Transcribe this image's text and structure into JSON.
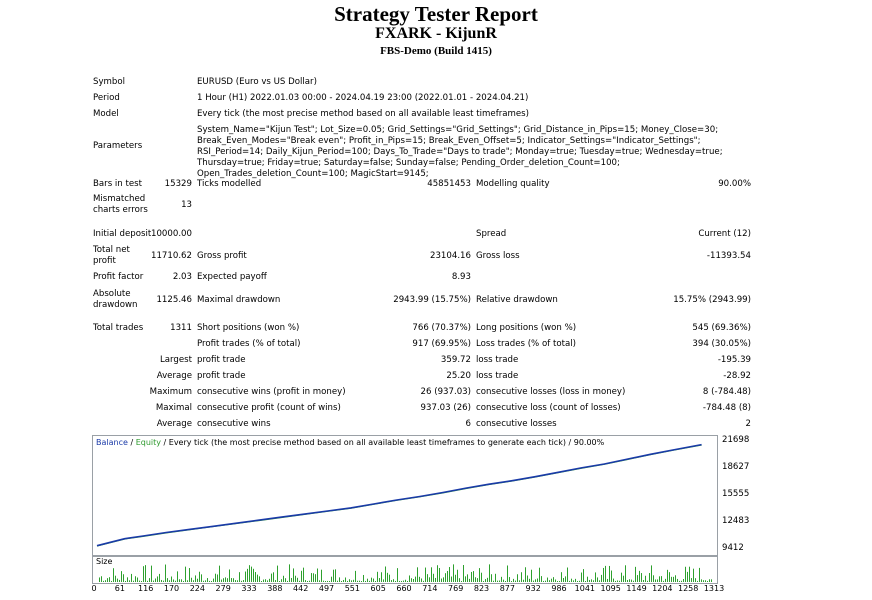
{
  "report": {
    "title": "Strategy Tester Report",
    "subtitle": "FXARK - KijunR",
    "server": "FBS-Demo (Build 1415)"
  },
  "info": {
    "symbol_label": "Symbol",
    "symbol": "EURUSD (Euro vs US Dollar)",
    "period_label": "Period",
    "period": "1 Hour (H1) 2022.01.03 00:00 - 2024.04.19 23:00 (2022.01.01 - 2024.04.21)",
    "model_label": "Model",
    "model": "Every tick (the most precise method based on all available least timeframes)",
    "parameters_label": "Parameters",
    "parameters": "System_Name=\"Kijun Test\"; Lot_Size=0.05; Grid_Settings=\"Grid_Settings\"; Grid_Distance_in_Pips=15; Money_Close=30; Break_Even_Modes=\"Break even\"; Profit_in_Pips=15; Break_Even_Offset=5; Indicator_Settings=\"Indicator_Settings\"; RSI_Period=14; Daily_Kijun_Period=100; Days_To_Trade=\"Days to trade\"; Monday=true; Tuesday=true; Wednesday=true; Thursday=true; Friday=true; Saturday=false; Sunday=false; Pending_Order_deletion_Count=100; Open_Trades_deletion_Count=100; MagicStart=9145;"
  },
  "stats": {
    "bars_label": "Bars in test",
    "bars": "15329",
    "ticks_label": "Ticks modelled",
    "ticks": "45851453",
    "quality_label": "Modelling quality",
    "quality": "90.00%",
    "mismatch_label": "Mismatched charts errors",
    "mismatch": "13",
    "deposit_label": "Initial deposit",
    "deposit": "10000.00",
    "spread_label": "Spread",
    "spread": "Current (12)",
    "netprofit_label": "Total net profit",
    "netprofit": "11710.62",
    "grossprofit_label": "Gross profit",
    "grossprofit": "23104.16",
    "grossloss_label": "Gross loss",
    "grossloss": "-11393.54",
    "pf_label": "Profit factor",
    "pf": "2.03",
    "payoff_label": "Expected payoff",
    "payoff": "8.93",
    "absdd_label": "Absolute drawdown",
    "absdd": "1125.46",
    "maxdd_label": "Maximal drawdown",
    "maxdd": "2943.99 (15.75%)",
    "reldd_label": "Relative drawdown",
    "reldd": "15.75% (2943.99)",
    "trades_label": "Total trades",
    "trades": "1311",
    "short_label": "Short positions (won %)",
    "short": "766 (70.37%)",
    "long_label": "Long positions (won %)",
    "long": "545 (69.36%)",
    "ptrades_label": "Profit trades (% of total)",
    "ptrades": "917 (69.95%)",
    "ltrades_label": "Loss trades (% of total)",
    "ltrades": "394 (30.05%)",
    "largest_label": "Largest",
    "profit_trade_label": "profit trade",
    "largest_profit": "359.72",
    "loss_trade_label": "loss trade",
    "largest_loss": "-195.39",
    "average_label": "Average",
    "avg_profit": "25.20",
    "avg_loss": "-28.92",
    "maximum_label": "Maximum",
    "cons_wins_money_label": "consecutive wins (profit in money)",
    "cons_wins_money": "26 (937.03)",
    "cons_losses_money_label": "consecutive losses (loss in money)",
    "cons_losses_money": "8 (-784.48)",
    "maximal_label": "Maximal",
    "cons_profit_count_label": "consecutive profit (count of wins)",
    "cons_profit_count": "937.03 (26)",
    "cons_loss_count_label": "consecutive loss (count of losses)",
    "cons_loss_count": "-784.48 (8)",
    "average2_label": "Average",
    "cons_wins_label": "consecutive wins",
    "cons_wins": "6",
    "cons_losses_label": "consecutive losses",
    "cons_losses": "2"
  },
  "chart_data": {
    "type": "line",
    "legend": {
      "balance": "Balance",
      "sep": " / ",
      "equity": "Equity",
      "rest": " / Every tick (the most precise method based on all available least timeframes to generate each tick) / 90.00%"
    },
    "size_label": "Size",
    "x_ticks": [
      "0",
      "61",
      "116",
      "170",
      "224",
      "279",
      "333",
      "388",
      "442",
      "497",
      "551",
      "605",
      "660",
      "714",
      "769",
      "823",
      "877",
      "932",
      "986",
      "1041",
      "1095",
      "1149",
      "1204",
      "1258",
      "1313"
    ],
    "x_range": [
      0,
      1340
    ],
    "y_ticks": [
      "21698",
      "18627",
      "15555",
      "12483",
      "9412"
    ],
    "y_range": [
      9412,
      21698
    ],
    "series": [
      {
        "name": "Balance",
        "color": "#1a3aa8",
        "x": [
          0,
          30,
          60,
          100,
          150,
          200,
          250,
          300,
          350,
          400,
          450,
          500,
          550,
          600,
          650,
          700,
          750,
          800,
          850,
          900,
          950,
          1000,
          1050,
          1100,
          1150,
          1200,
          1250,
          1311
        ],
        "y": [
          9900,
          10300,
          10700,
          11000,
          11400,
          11750,
          12100,
          12450,
          12800,
          13150,
          13500,
          13850,
          14200,
          14650,
          15100,
          15500,
          15950,
          16450,
          16900,
          17300,
          17750,
          18250,
          18750,
          19200,
          19750,
          20300,
          20800,
          21400
        ]
      },
      {
        "name": "Equity",
        "color": "#2e9a2e",
        "x": [
          0,
          30,
          60,
          100,
          150,
          200,
          250,
          300,
          350,
          400,
          450,
          500,
          550,
          600,
          650,
          700,
          750,
          800,
          850,
          900,
          950,
          1000,
          1050,
          1100,
          1150,
          1200,
          1250,
          1311
        ],
        "y": [
          9850,
          10250,
          10650,
          10950,
          11350,
          11700,
          12050,
          12400,
          12750,
          13100,
          13450,
          13800,
          14150,
          14600,
          15050,
          15450,
          15900,
          16400,
          16850,
          17250,
          17700,
          18200,
          18700,
          19150,
          19700,
          20250,
          20750,
          21350
        ]
      }
    ]
  }
}
